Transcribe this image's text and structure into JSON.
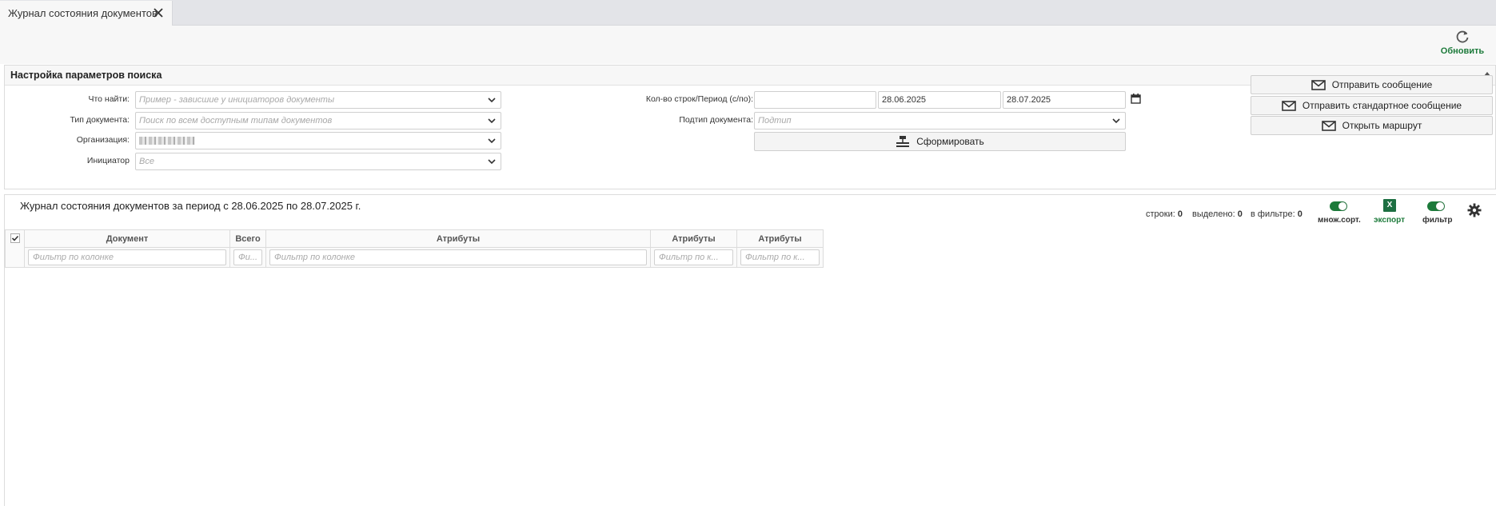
{
  "tab": {
    "title": "Журнал состояния документов"
  },
  "toolbar": {
    "refresh_label": "Обновить"
  },
  "search_panel": {
    "title": "Настройка параметров поиска",
    "what_label": "Что найти:",
    "what_placeholder": "Пример - зависшие у инициаторов документы",
    "doctype_label": "Тип документа:",
    "doctype_placeholder": "Поиск по всем доступным типам документов",
    "org_label": "Организация:",
    "initiator_label": "Инициатор",
    "initiator_placeholder": "Все",
    "rows_period_label": "Кол-во строк/Период (с/по):",
    "rows_value": "",
    "date_from": "28.06.2025",
    "date_to": "28.07.2025",
    "subtype_label": "Подтип документа:",
    "subtype_placeholder": "Подтип",
    "form_button": "Сформировать",
    "send_message": "Отправить сообщение",
    "send_standard_message": "Отправить стандартное сообщение",
    "open_route": "Открыть маршрут"
  },
  "journal": {
    "title": "Журнал состояния документов за период с 28.06.2025 по 28.07.2025 г.",
    "rows_label": "строки:",
    "rows_count": "0",
    "selected_label": "выделено:",
    "selected_count": "0",
    "filtered_label": "в фильтре:",
    "filtered_count": "0",
    "multisort_label": "множ.сорт.",
    "export_label": "экспорт",
    "export_icon_text": "X",
    "filter_label": "фильтр",
    "columns": [
      {
        "header": "Документ",
        "filter_placeholder": "Фильтр по колонке"
      },
      {
        "header": "Всего",
        "filter_placeholder": "Фи..."
      },
      {
        "header": "Атрибуты",
        "filter_placeholder": "Фильтр по колонке"
      },
      {
        "header": "Атрибуты",
        "filter_placeholder": "Фильтр по к..."
      },
      {
        "header": "Атрибуты",
        "filter_placeholder": "Фильтр по к..."
      }
    ]
  },
  "colors": {
    "accent_green": "#1c7a3a",
    "excel_green": "#1d6f42"
  }
}
